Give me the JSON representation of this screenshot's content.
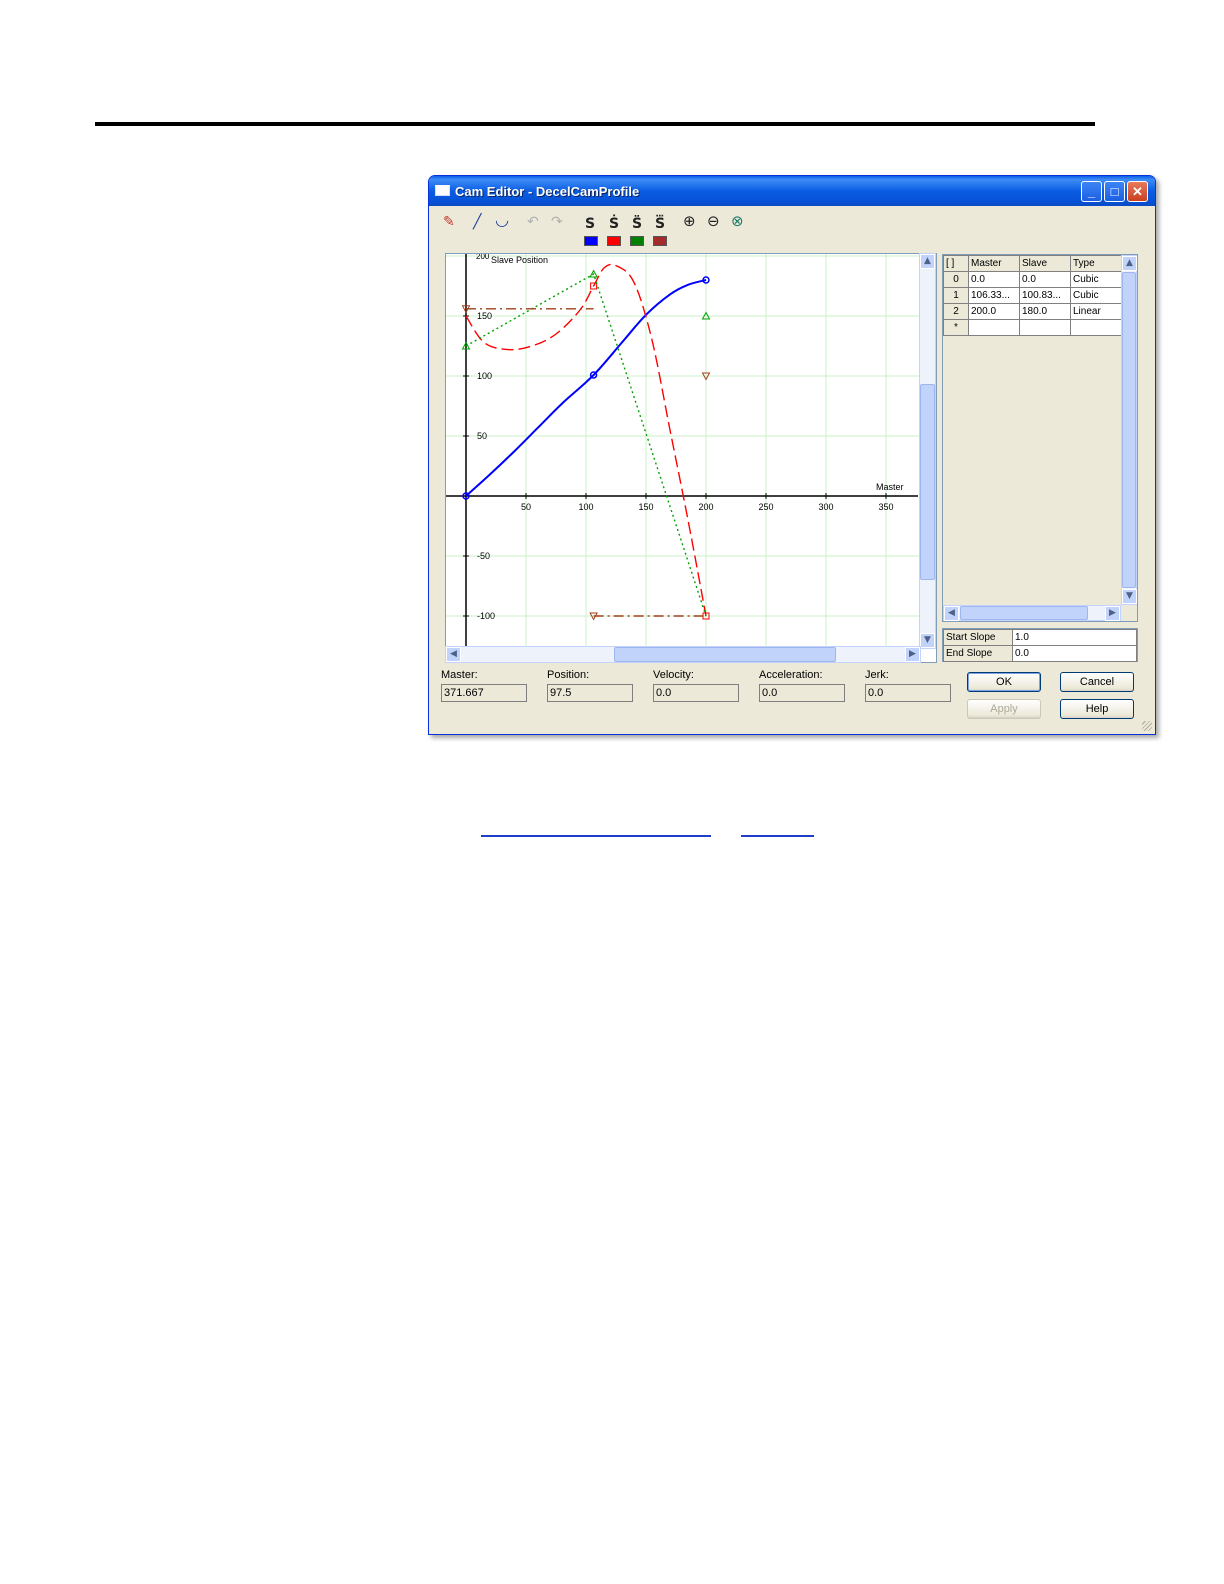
{
  "window": {
    "title": "Cam Editor - DecelCamProfile"
  },
  "toolbar": {
    "tools": [
      "pen-icon",
      "line-icon",
      "curve-icon",
      "undo-icon",
      "redo-icon",
      "zoom-in-icon",
      "zoom-out-icon",
      "zoom-fit-icon"
    ],
    "series_buttons": [
      {
        "label": "S",
        "name": "position",
        "color": "#0000ff"
      },
      {
        "label": "Ṡ",
        "name": "velocity",
        "color": "#ff0000"
      },
      {
        "label": "S̈",
        "name": "acceleration",
        "color": "#008000"
      },
      {
        "label": "S⃛",
        "name": "jerk",
        "color": "#a52a2a"
      }
    ]
  },
  "chart_data": {
    "type": "line",
    "ylabel": "Slave Position",
    "xlabel": "Master",
    "xlim": [
      0,
      375
    ],
    "ylim": [
      -125,
      200
    ],
    "x_ticks": [
      50,
      100,
      150,
      200,
      250,
      300,
      350
    ],
    "y_ticks": [
      200,
      150,
      100,
      50,
      -50,
      -100
    ],
    "y_tick_label_top": "200",
    "grid": true,
    "series": [
      {
        "key": "position",
        "color": "#0000ff",
        "style": "solid",
        "x": [
          0,
          20,
          40,
          60,
          80,
          106.33,
          130,
          150,
          170,
          185,
          200
        ],
        "y": [
          0,
          18,
          37,
          57,
          77,
          100.83,
          128,
          151,
          168,
          176,
          180
        ],
        "markers": [
          [
            0,
            0
          ],
          [
            106.33,
            100.83
          ],
          [
            200,
            180
          ]
        ]
      },
      {
        "key": "velocity",
        "color": "#ff0000",
        "style": "dashed",
        "x": [
          0,
          15,
          35,
          55,
          75,
          95,
          106.33,
          115,
          125,
          140,
          155,
          170,
          185,
          200
        ],
        "y": [
          150,
          128,
          122,
          125,
          135,
          155,
          175,
          190,
          192,
          178,
          130,
          55,
          -20,
          -100
        ],
        "markers": [
          [
            106.33,
            175
          ],
          [
            200,
            -100
          ]
        ]
      },
      {
        "key": "acceleration",
        "color": "#00a000",
        "style": "dotted",
        "x": [
          0,
          106.33,
          200
        ],
        "y": [
          125,
          185,
          -100
        ],
        "markers": [
          [
            0,
            125
          ],
          [
            106.33,
            185
          ],
          [
            200,
            150
          ]
        ]
      },
      {
        "key": "jerk",
        "color": "#a0401a",
        "style": "dashdot",
        "segments": [
          {
            "x": [
              0,
              106.33
            ],
            "y": [
              156,
              156
            ]
          },
          {
            "x": [
              106.33,
              200
            ],
            "y": [
              -100,
              -100
            ]
          }
        ],
        "markers": [
          [
            0,
            156
          ],
          [
            106.33,
            -100
          ],
          [
            200,
            100
          ]
        ]
      }
    ]
  },
  "table": {
    "headers": [
      "[ ]",
      "Master",
      "Slave",
      "Type"
    ],
    "rows": [
      {
        "index": "0",
        "master": "0.0",
        "slave": "0.0",
        "type": "Cubic"
      },
      {
        "index": "1",
        "master": "106.33...",
        "slave": "100.83...",
        "type": "Cubic"
      },
      {
        "index": "2",
        "master": "200.0",
        "slave": "180.0",
        "type": "Linear"
      },
      {
        "index": "*",
        "master": "",
        "slave": "",
        "type": ""
      }
    ]
  },
  "slopes": {
    "start_label": "Start Slope",
    "start_value": "1.0",
    "end_label": "End Slope",
    "end_value": "0.0"
  },
  "fields": {
    "master_label": "Master:",
    "master_value": "371.667",
    "position_label": "Position:",
    "position_value": "97.5",
    "velocity_label": "Velocity:",
    "velocity_value": "0.0",
    "acceleration_label": "Acceleration:",
    "acceleration_value": "0.0",
    "jerk_label": "Jerk:",
    "jerk_value": "0.0"
  },
  "buttons": {
    "ok": "OK",
    "cancel": "Cancel",
    "apply": "Apply",
    "help": "Help"
  }
}
